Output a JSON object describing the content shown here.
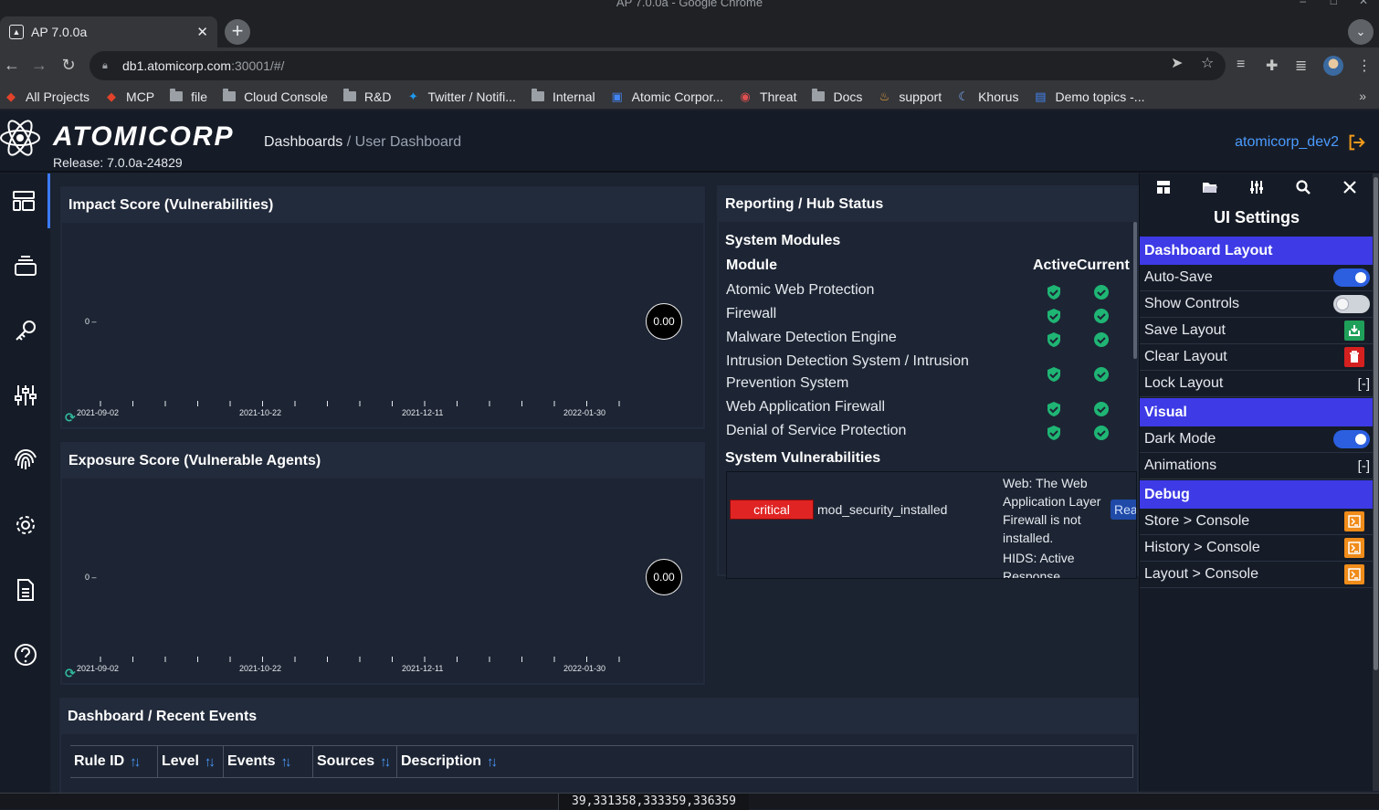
{
  "window": {
    "title": "AP 7.0.0a - Google Chrome"
  },
  "browser": {
    "tab_title": "AP 7.0.0a",
    "url_host": "db1.atomicorp.com",
    "url_rest": ":30001/#/",
    "bookmarks": [
      {
        "label": "All Projects",
        "icon": "gitlab-icon"
      },
      {
        "label": "MCP",
        "icon": "gitlab-icon"
      },
      {
        "label": "file",
        "icon": "folder-icon"
      },
      {
        "label": "Cloud Console",
        "icon": "folder-icon"
      },
      {
        "label": "R&D",
        "icon": "folder-icon"
      },
      {
        "label": "Twitter / Notifi...",
        "icon": "twitter-icon"
      },
      {
        "label": "Internal",
        "icon": "folder-icon"
      },
      {
        "label": "Atomic Corpor...",
        "icon": "calendar-icon"
      },
      {
        "label": "Threat",
        "icon": "threat-icon"
      },
      {
        "label": "Docs",
        "icon": "folder-icon"
      },
      {
        "label": "support",
        "icon": "support-icon"
      },
      {
        "label": "Khorus",
        "icon": "khorus-icon"
      },
      {
        "label": "Demo topics -...",
        "icon": "docs-icon"
      }
    ]
  },
  "app": {
    "logo": "ATOMICORP",
    "breadcrumb": {
      "root": "Dashboards",
      "sep": "/",
      "current": "User Dashboard"
    },
    "release": "Release: 7.0.0a-24829",
    "user": "atomicorp_dev2"
  },
  "impact": {
    "title": "Impact Score (Vulnerabilities)",
    "score": "0.00",
    "y_tick": "0 –",
    "x_labels": [
      "2021-09-02",
      "2021-10-22",
      "2021-12-11",
      "2022-01-30"
    ]
  },
  "exposure": {
    "title": "Exposure Score (Vulnerable Agents)",
    "score": "0.00",
    "y_tick": "0 –",
    "x_labels": [
      "2021-09-02",
      "2021-10-22",
      "2021-12-11",
      "2022-01-30"
    ]
  },
  "hub": {
    "title": "Reporting / Hub Status",
    "modules_heading": "System Modules",
    "col_module": "Module",
    "col_active": "Active",
    "col_current": "Current",
    "modules": [
      {
        "line1": "Atomic Web Protection",
        "line2": ""
      },
      {
        "line1": "Firewall",
        "line2": ""
      },
      {
        "line1": "Malware Detection Engine",
        "line2": ""
      },
      {
        "line1": "Intrusion Detection System / Intrusion",
        "line2": "Prevention System"
      },
      {
        "line1": "Web Application Firewall",
        "line2": ""
      },
      {
        "line1": "Denial of Service Protection",
        "line2": ""
      }
    ],
    "vuln_heading": "System Vulnerabilities",
    "vuln": {
      "severity": "critical",
      "name": "mod_security_installed",
      "desc1": "Web: The Web Application Layer Firewall is not installed.",
      "desc2": "HIDS: Active Response",
      "action": "Rea"
    },
    "status_color": "#1fb574"
  },
  "events": {
    "title": "Dashboard / Recent Events",
    "columns": [
      "Rule ID",
      "Level",
      "Events",
      "Sources",
      "Description"
    ]
  },
  "ui_settings": {
    "title": "UI Settings",
    "sections": {
      "layout": "Dashboard Layout",
      "visual": "Visual",
      "debug": "Debug"
    },
    "rows": {
      "auto_save": "Auto-Save",
      "show_controls": "Show Controls",
      "save_layout": "Save Layout",
      "clear_layout": "Clear Layout",
      "lock_layout": "Lock Layout",
      "lock_state": "[-]",
      "dark_mode": "Dark Mode",
      "animations": "Animations",
      "anim_state": "[-]",
      "store_console": "Store > Console",
      "history_console": "History > Console",
      "layout_console": "Layout > Console"
    },
    "toggles": {
      "auto_save": true,
      "show_controls": false,
      "dark_mode": true
    }
  },
  "statusbar": {
    "text": "39,331358,333359,336359"
  }
}
